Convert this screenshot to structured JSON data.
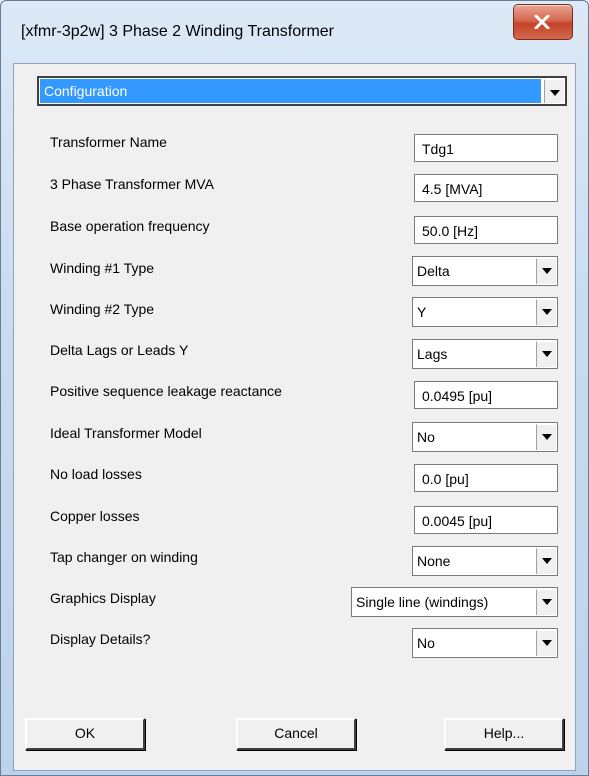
{
  "window": {
    "title": "[xfmr-3p2w] 3 Phase 2 Winding Transformer"
  },
  "section_select": {
    "value": "Configuration"
  },
  "params": [
    {
      "label": "Transformer Name",
      "value": "Tdg1",
      "type": "text"
    },
    {
      "label": "3 Phase Transformer MVA",
      "value": "4.5 [MVA]",
      "type": "text"
    },
    {
      "label": "Base operation frequency",
      "value": "50.0 [Hz]",
      "type": "text"
    },
    {
      "label": "Winding #1 Type",
      "value": "Delta",
      "type": "select"
    },
    {
      "label": "Winding #2 Type",
      "value": "Y",
      "type": "select"
    },
    {
      "label": "Delta Lags or Leads Y",
      "value": "Lags",
      "type": "select"
    },
    {
      "label": "Positive sequence leakage reactance",
      "value": "0.0495 [pu]",
      "type": "text"
    },
    {
      "label": "Ideal Transformer Model",
      "value": "No",
      "type": "select"
    },
    {
      "label": "No load losses",
      "value": "0.0 [pu]",
      "type": "text"
    },
    {
      "label": "Copper losses",
      "value": "0.0045 [pu]",
      "type": "text"
    },
    {
      "label": "Tap changer on winding",
      "value": "None",
      "type": "select"
    },
    {
      "label": "Graphics Display",
      "value": "Single line (windings)",
      "type": "select"
    },
    {
      "label": "Display Details?",
      "value": "No",
      "type": "select"
    }
  ],
  "buttons": {
    "ok": "OK",
    "cancel": "Cancel",
    "help": "Help..."
  },
  "icons": {
    "close": "close-icon",
    "dropdown": "chevron-down-icon"
  },
  "colors": {
    "selection": "#3399ff",
    "close_button": "#c4432a",
    "frame": "#c9dcf0"
  }
}
